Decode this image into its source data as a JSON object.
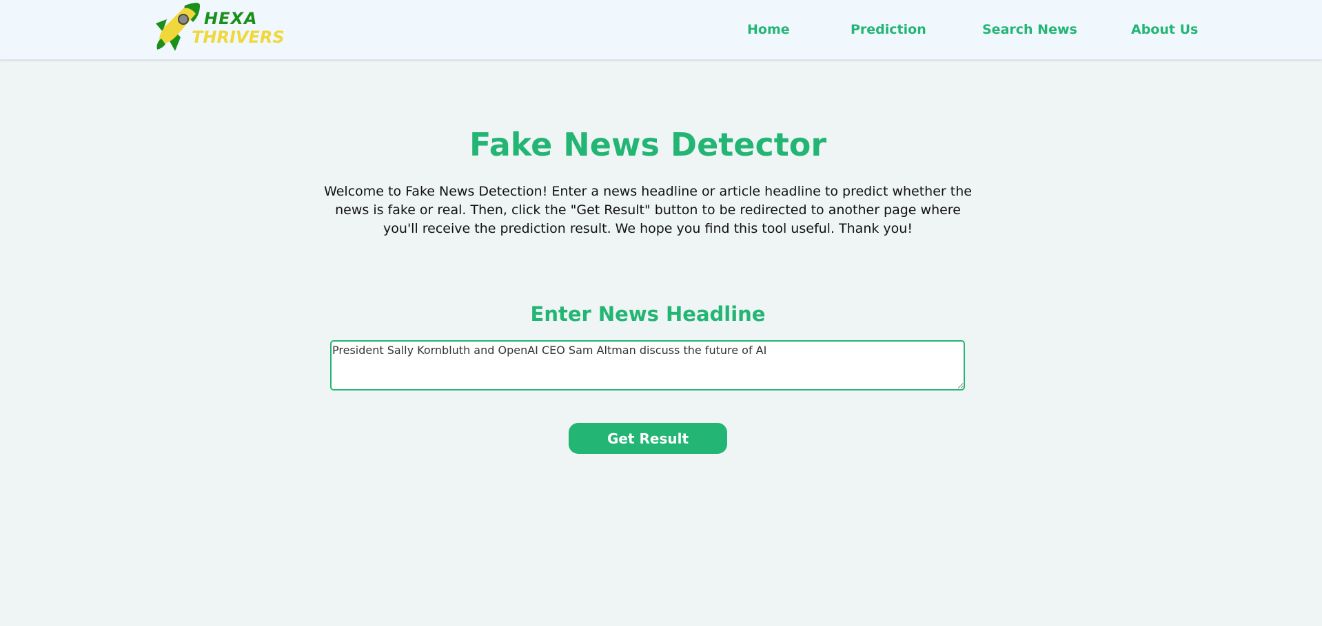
{
  "brand": {
    "line1": "HEXA",
    "line2": "THRIVERS",
    "logo_icon": "rocket-icon"
  },
  "nav": {
    "items": [
      {
        "label": "Home"
      },
      {
        "label": "Prediction"
      },
      {
        "label": "Search News"
      },
      {
        "label": "About Us"
      }
    ]
  },
  "main": {
    "title": "Fake News Detector",
    "intro": "Welcome to Fake News Detection! Enter a news headline or article headline to predict whether the news is fake or real. Then, click the \"Get Result\" button to be redirected to another page where you'll receive the prediction result. We hope you find this tool useful. Thank you!",
    "input_heading": "Enter News Headline",
    "input_value": "President Sally Kornbluth and OpenAI CEO Sam Altman discuss the future of AI",
    "submit_label": "Get Result"
  },
  "colors": {
    "accent": "#22b573",
    "logo_green": "#1a8f1a",
    "logo_yellow": "#f0d83a",
    "navbar_bg": "#f0f8fd",
    "page_bg": "#eff4f4"
  }
}
